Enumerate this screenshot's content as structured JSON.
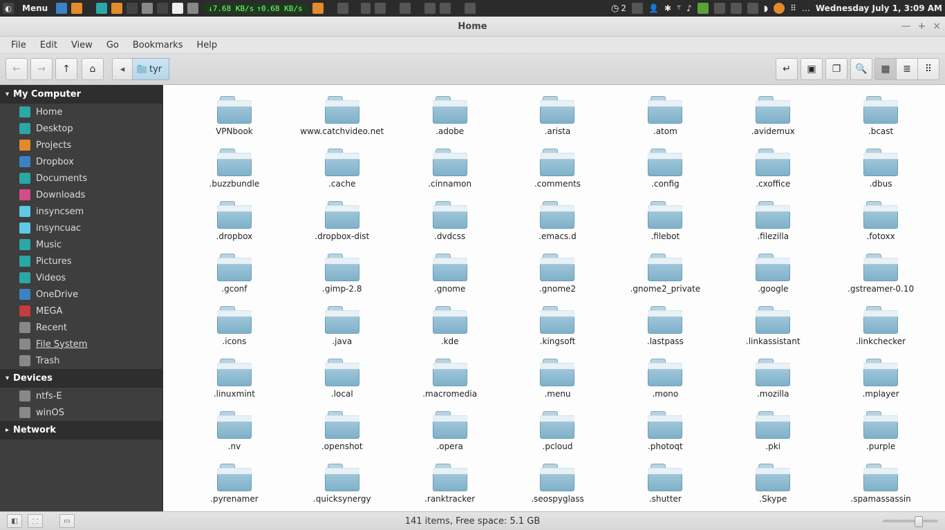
{
  "panel": {
    "menu_label": "Menu",
    "net_down": "↓7.68 KB/s",
    "net_up": "↑0.68 KB/s",
    "workspace_count": "2",
    "clock": "Wednesday July  1,  3:09 AM"
  },
  "window": {
    "title": "Home",
    "win_controls": {
      "min": "—",
      "max": "+",
      "close": "×"
    },
    "menu": {
      "file": "File",
      "edit": "Edit",
      "view": "View",
      "go": "Go",
      "bookmarks": "Bookmarks",
      "help": "Help"
    },
    "path": {
      "segment": "tyr"
    }
  },
  "sidebar": {
    "headers": {
      "my_computer": "My Computer",
      "devices": "Devices",
      "network": "Network"
    },
    "items": [
      {
        "label": "Home",
        "icon": "bg-teal"
      },
      {
        "label": "Desktop",
        "icon": "bg-teal"
      },
      {
        "label": "Projects",
        "icon": "bg-orange"
      },
      {
        "label": "Dropbox",
        "icon": "bg-blue"
      },
      {
        "label": "Documents",
        "icon": "bg-teal"
      },
      {
        "label": "Downloads",
        "icon": "bg-pink"
      },
      {
        "label": "insyncsem",
        "icon": "bg-cyan"
      },
      {
        "label": "insyncuac",
        "icon": "bg-cyan"
      },
      {
        "label": "Music",
        "icon": "bg-teal"
      },
      {
        "label": "Pictures",
        "icon": "bg-teal"
      },
      {
        "label": "Videos",
        "icon": "bg-teal"
      },
      {
        "label": "OneDrive",
        "icon": "bg-blue"
      },
      {
        "label": "MEGA",
        "icon": "bg-red"
      },
      {
        "label": "Recent",
        "icon": "bg-grey"
      },
      {
        "label": "File System",
        "icon": "bg-grey",
        "selected": true
      },
      {
        "label": "Trash",
        "icon": "bg-grey"
      }
    ],
    "devices": [
      {
        "label": "ntfs-E",
        "icon": "bg-grey"
      },
      {
        "label": "winOS",
        "icon": "bg-grey"
      }
    ]
  },
  "folders": [
    "VPNbook",
    "www.catchvideo.net",
    ".adobe",
    ".arista",
    ".atom",
    ".avidemux",
    ".bcast",
    ".buzzbundle",
    ".cache",
    ".cinnamon",
    ".comments",
    ".config",
    ".cxoffice",
    ".dbus",
    ".dropbox",
    ".dropbox-dist",
    ".dvdcss",
    ".emacs.d",
    ".filebot",
    ".filezilla",
    ".fotoxx",
    ".gconf",
    ".gimp-2.8",
    ".gnome",
    ".gnome2",
    ".gnome2_private",
    ".google",
    ".gstreamer-0.10",
    ".icons",
    ".java",
    ".kde",
    ".kingsoft",
    ".lastpass",
    ".linkassistant",
    ".linkchecker",
    ".linuxmint",
    ".local",
    ".macromedia",
    ".menu",
    ".mono",
    ".mozilla",
    ".mplayer",
    ".nv",
    ".openshot",
    ".opera",
    ".pcloud",
    ".photoqt",
    ".pki",
    ".purple",
    ".pyrenamer",
    ".quicksynergy",
    ".ranktracker",
    ".seospyglass",
    ".shutter",
    ".Skype",
    ".spamassassin"
  ],
  "status": {
    "text": "141 items, Free space: 5.1 GB"
  }
}
